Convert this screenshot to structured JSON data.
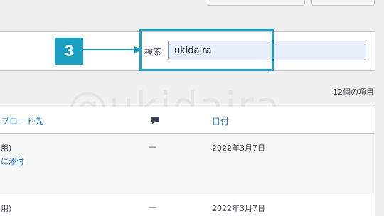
{
  "badge": {
    "number": "3"
  },
  "search": {
    "label": "検索",
    "value": "ukidaira"
  },
  "list": {
    "item_count": "12個の項目"
  },
  "watermark": "@ukidaira",
  "table": {
    "columns": {
      "uploaded_to": "プロード先",
      "date": "日付"
    },
    "rows": [
      {
        "uploaded_line1": "用)",
        "uploaded_line2": "に添付",
        "comments": "—",
        "date": "2022年3月7日"
      },
      {
        "uploaded_line1": "用)",
        "comments": "—",
        "date": "2022年3月7日"
      }
    ]
  },
  "colors": {
    "highlight": "#1ba0c4",
    "link": "#2271b1",
    "input_bg": "#e8f0fe"
  }
}
